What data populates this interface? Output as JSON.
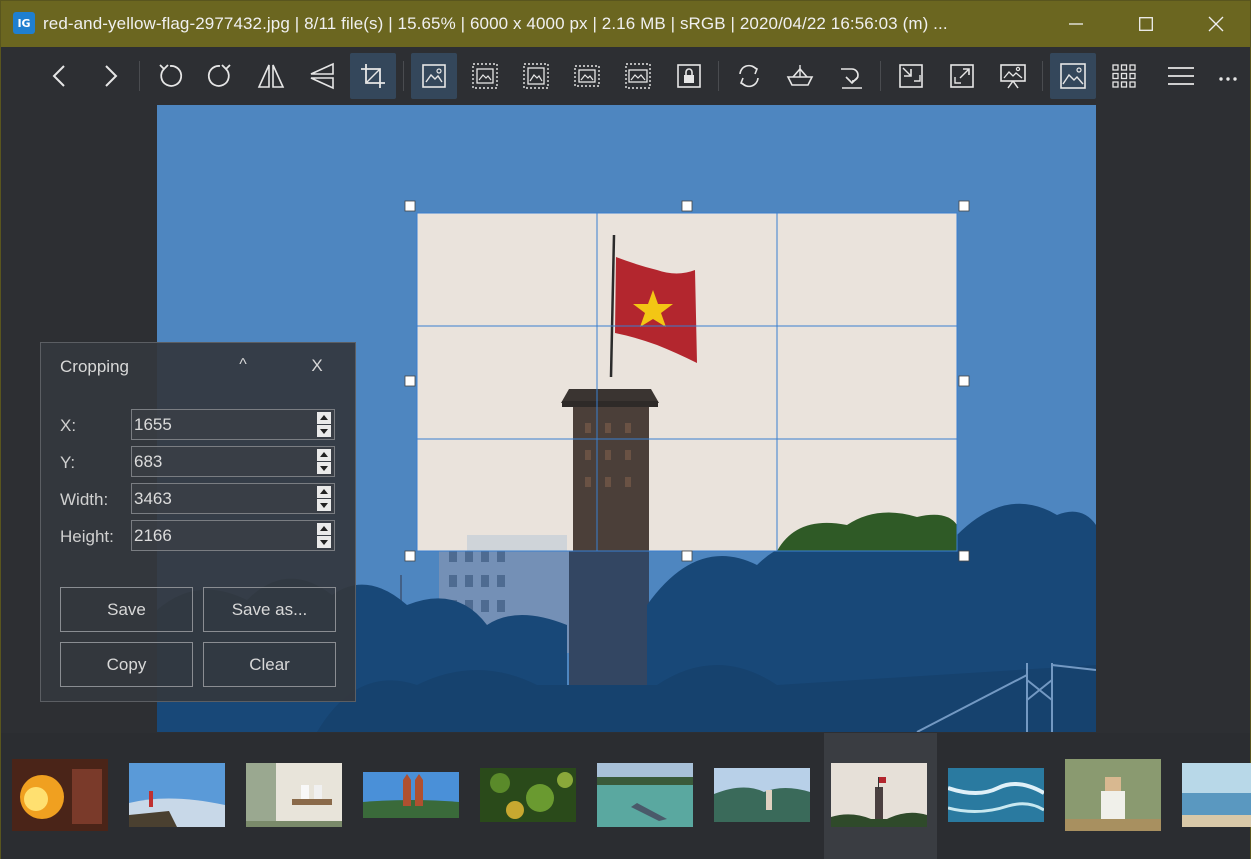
{
  "titlebar": {
    "app_icon_text": "IG",
    "title": "red-and-yellow-flag-2977432.jpg  |  8/11 file(s)  |  15.65%  |  6000 x 4000 px  |  2.16 MB  |  sRGB  |  2020/04/22 16:56:03 (m)  ...",
    "minimize_icon": "minimize-icon",
    "maximize_icon": "maximize-icon",
    "close_icon": "close-icon"
  },
  "toolbar": {
    "buttons": [
      {
        "name": "previous-image",
        "icon": "chevron-left-icon"
      },
      {
        "name": "next-image",
        "icon": "chevron-right-icon"
      },
      {
        "name": "rotate-left",
        "icon": "rotate-ccw-icon"
      },
      {
        "name": "rotate-right",
        "icon": "rotate-cw-icon"
      },
      {
        "name": "flip-horizontal",
        "icon": "flip-horizontal-icon"
      },
      {
        "name": "flip-vertical",
        "icon": "flip-vertical-icon"
      },
      {
        "name": "crop",
        "icon": "crop-icon",
        "active": true
      },
      {
        "name": "view-actual-size",
        "icon": "image-icon",
        "active": true
      },
      {
        "name": "auto-zoom",
        "icon": "image-dashed-icon"
      },
      {
        "name": "lock-zoom",
        "icon": "image-dashed-icon"
      },
      {
        "name": "scale-to-width",
        "icon": "image-dashed-icon"
      },
      {
        "name": "scale-to-fill",
        "icon": "image-dashed-icon"
      },
      {
        "name": "lock-view",
        "icon": "lock-icon"
      },
      {
        "name": "refresh",
        "icon": "refresh-icon"
      },
      {
        "name": "checkerboard",
        "icon": "boat-icon"
      },
      {
        "name": "save-image",
        "icon": "arrow-down-icon"
      },
      {
        "name": "frameless",
        "icon": "compress-icon"
      },
      {
        "name": "fullscreen",
        "icon": "expand-icon"
      },
      {
        "name": "slideshow",
        "icon": "presentation-icon"
      },
      {
        "name": "toggle-thumbnails",
        "icon": "image-icon",
        "active": true
      },
      {
        "name": "gallery",
        "icon": "grid-icon"
      },
      {
        "name": "main-menu",
        "icon": "hamburger-icon"
      },
      {
        "name": "more",
        "icon": "ellipsis-icon"
      }
    ]
  },
  "crop_panel": {
    "title": "Cropping",
    "collapse_label": "^",
    "close_label": "X",
    "fields": {
      "x_label": "X:",
      "x_value": "1655",
      "y_label": "Y:",
      "y_value": "683",
      "width_label": "Width:",
      "width_value": "3463",
      "height_label": "Height:",
      "height_value": "2166"
    },
    "buttons": {
      "save": "Save",
      "save_as": "Save as...",
      "copy": "Copy",
      "clear": "Clear"
    }
  },
  "thumbnails": {
    "count": 11,
    "selected_index": 7,
    "items": [
      "fire-breather",
      "person-on-rock",
      "couple-on-bench",
      "cathedral",
      "forest-aerial",
      "river-boats",
      "bay-hiker",
      "flag-tower",
      "ocean-aerial",
      "old-man",
      "beach-sea"
    ]
  },
  "colors": {
    "titlebar_bg": "#6b6620",
    "toolbar_active": "#34475b",
    "crop_grid": "#3a7fd0",
    "sky": "#6aa8dc"
  }
}
